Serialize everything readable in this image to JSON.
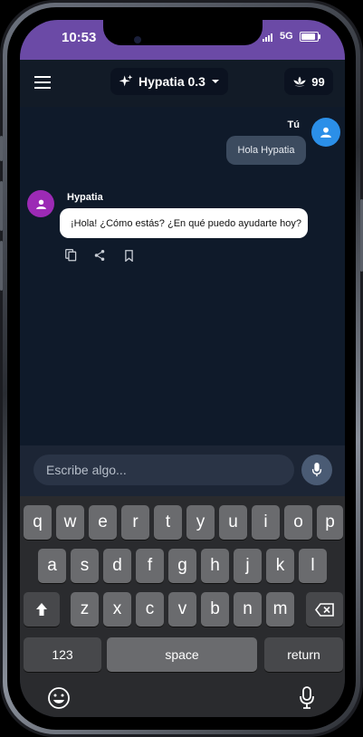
{
  "status": {
    "time": "10:53",
    "network": "5G"
  },
  "appbar": {
    "model_label": "Hypatia 0.3",
    "credits": "99"
  },
  "chat": {
    "user_name": "Tú",
    "user_message": "Hola Hypatia",
    "bot_name": "Hypatia",
    "bot_message": "¡Hola! ¿Cómo estás? ¿En qué puedo ayudarte hoy?"
  },
  "input": {
    "placeholder": "Escribe algo..."
  },
  "keyboard": {
    "row1": [
      "q",
      "w",
      "e",
      "r",
      "t",
      "y",
      "u",
      "i",
      "o",
      "p"
    ],
    "row2": [
      "a",
      "s",
      "d",
      "f",
      "g",
      "h",
      "j",
      "k",
      "l"
    ],
    "row3": [
      "z",
      "x",
      "c",
      "v",
      "b",
      "n",
      "m"
    ],
    "numbers_label": "123",
    "space_label": "space",
    "return_label": "return"
  },
  "colors": {
    "statusbar": "#6b4aa6",
    "user_avatar": "#2b8fe8",
    "bot_avatar": "#9c2ab5",
    "background": "#0f1a2a"
  }
}
